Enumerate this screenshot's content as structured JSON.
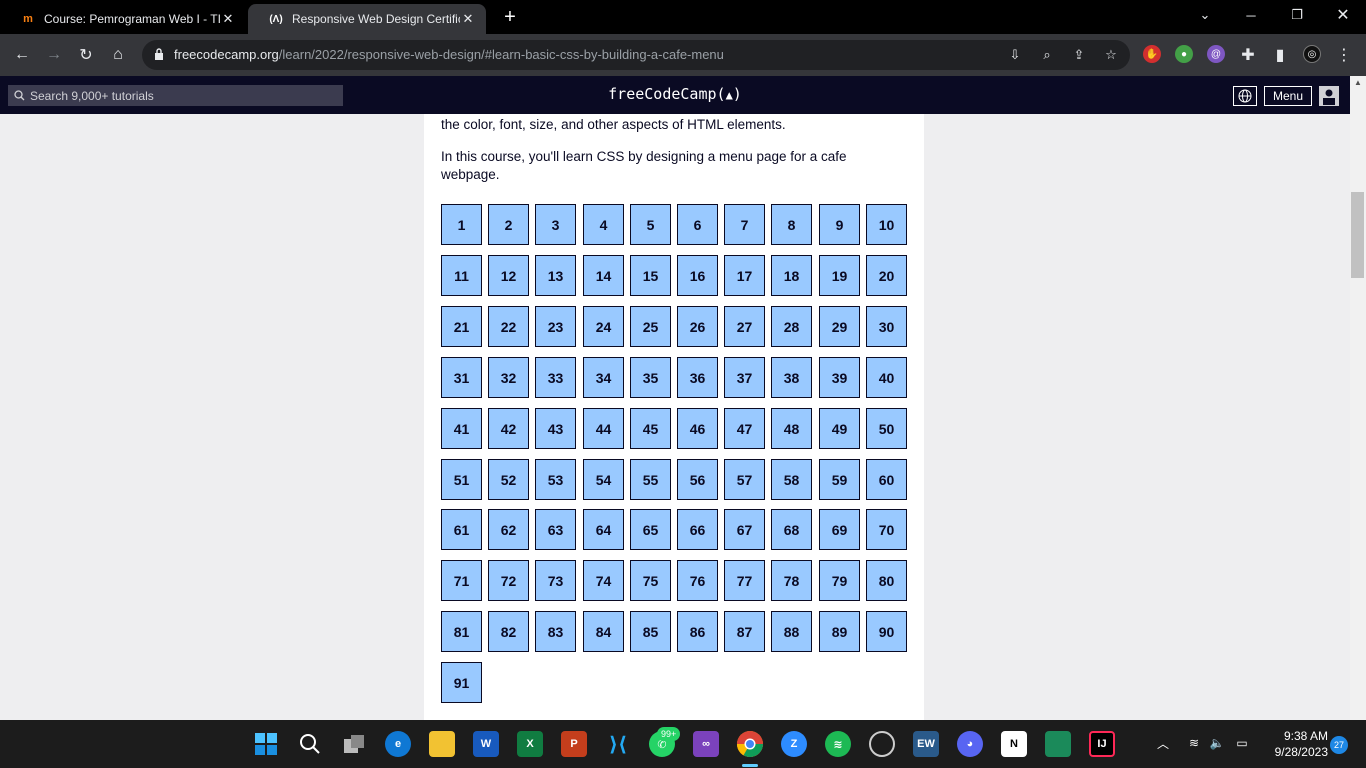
{
  "browser": {
    "tabs": [
      {
        "title": "Course: Pemrograman Web I - TI",
        "favicon": "moodle-icon"
      },
      {
        "title": "Responsive Web Design Certifica",
        "favicon": "freecodecamp-icon",
        "active": true
      }
    ],
    "url_host": "freecodecamp.org",
    "url_path": "/learn/2022/responsive-web-design/#learn-basic-css-by-building-a-cafe-menu"
  },
  "fcc_nav": {
    "search_placeholder": "Search 9,000+ tutorials",
    "brand": "freeCodeCamp(🔥)",
    "menu_label": "Menu"
  },
  "content": {
    "intro_partial": "the color, font, size, and other aspects of HTML elements.",
    "intro_line1": "In this course, you'll learn CSS by designing a menu page for a cafe",
    "intro_line2": "webpage.",
    "steps": [
      "1",
      "2",
      "3",
      "4",
      "5",
      "6",
      "7",
      "8",
      "9",
      "10",
      "11",
      "12",
      "13",
      "14",
      "15",
      "16",
      "17",
      "18",
      "19",
      "20",
      "21",
      "22",
      "23",
      "24",
      "25",
      "26",
      "27",
      "28",
      "29",
      "30",
      "31",
      "32",
      "33",
      "34",
      "35",
      "36",
      "37",
      "38",
      "39",
      "40",
      "41",
      "42",
      "43",
      "44",
      "45",
      "46",
      "47",
      "48",
      "49",
      "50",
      "51",
      "52",
      "53",
      "54",
      "55",
      "56",
      "57",
      "58",
      "59",
      "60",
      "61",
      "62",
      "63",
      "64",
      "65",
      "66",
      "67",
      "68",
      "69",
      "70",
      "71",
      "72",
      "73",
      "74",
      "75",
      "76",
      "77",
      "78",
      "79",
      "80",
      "81",
      "82",
      "83",
      "84",
      "85",
      "86",
      "87",
      "88",
      "89",
      "90",
      "91"
    ]
  },
  "taskbar": {
    "whatsapp_badge": "99+",
    "time": "9:38 AM",
    "date": "9/28/2023",
    "notifications": "27"
  },
  "colors": {
    "fcc_dark": "#0a0a23",
    "step_bg": "#99c9ff"
  }
}
